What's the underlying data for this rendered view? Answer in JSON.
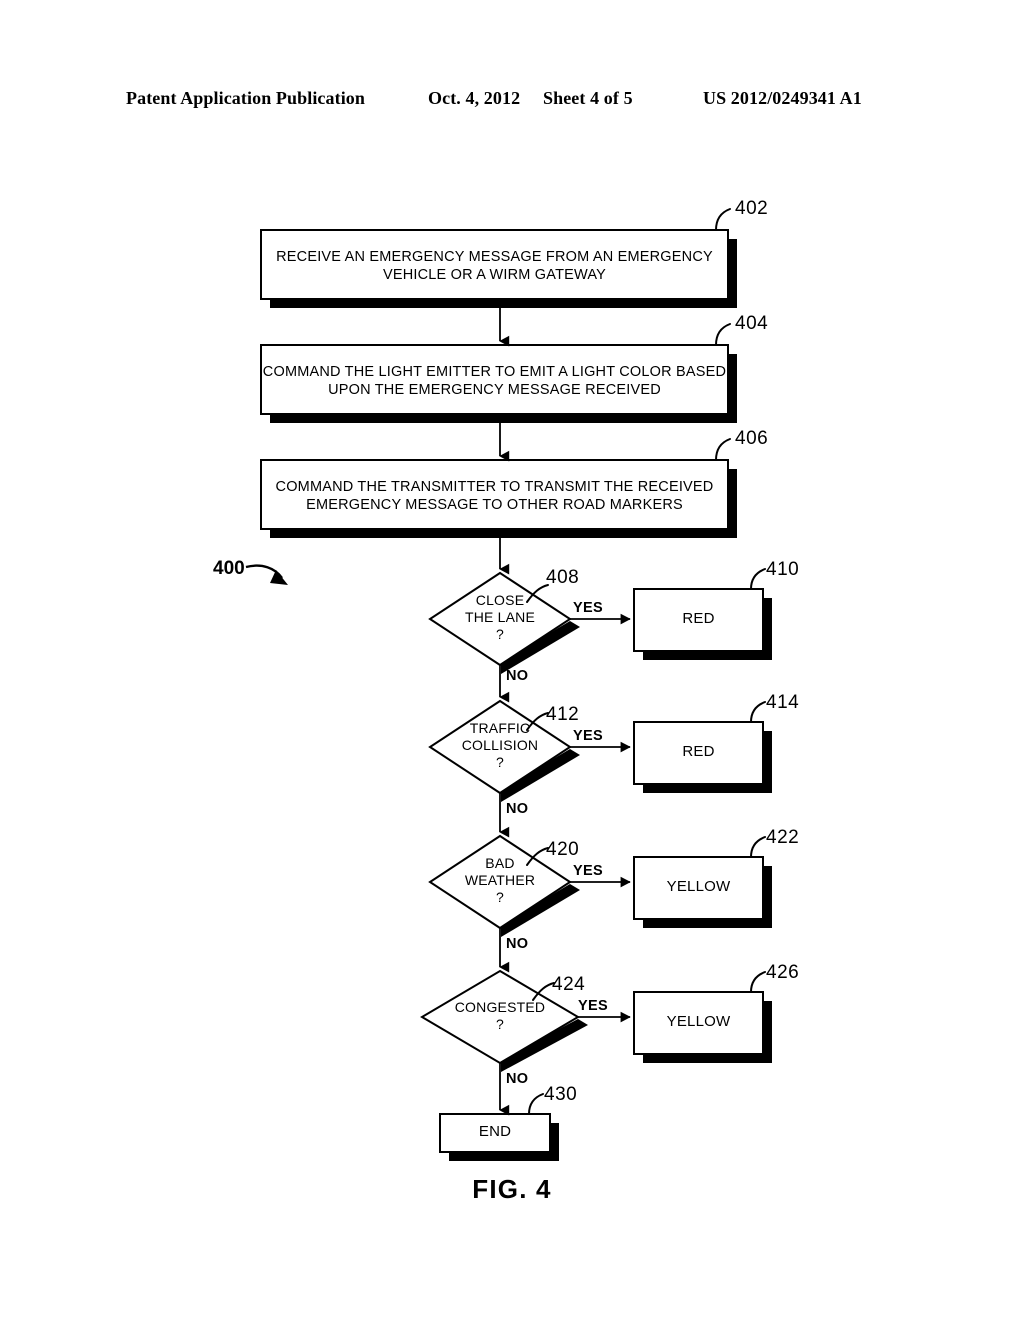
{
  "header": {
    "publication": "Patent Application Publication",
    "date": "Oct. 4, 2012",
    "sheet": "Sheet 4 of 5",
    "number": "US 2012/0249341 A1"
  },
  "figure": {
    "caption": "FIG. 4",
    "diagram_label": "400",
    "nodes": [
      {
        "id": "402",
        "ref": "402",
        "type": "process",
        "lines": [
          "RECEIVE AN EMERGENCY MESSAGE FROM AN EMERGENCY",
          "VEHICLE OR A WIRM GATEWAY"
        ]
      },
      {
        "id": "404",
        "ref": "404",
        "type": "process",
        "lines": [
          "COMMAND THE LIGHT EMITTER TO EMIT A LIGHT COLOR BASED",
          "UPON THE EMERGENCY MESSAGE RECEIVED"
        ]
      },
      {
        "id": "406",
        "ref": "406",
        "type": "process",
        "lines": [
          "COMMAND THE TRANSMITTER TO TRANSMIT THE RECEIVED",
          "EMERGENCY MESSAGE TO OTHER ROAD MARKERS"
        ]
      },
      {
        "id": "408",
        "ref": "408",
        "type": "decision",
        "lines": [
          "CLOSE",
          "THE LANE",
          "?"
        ]
      },
      {
        "id": "410",
        "ref": "410",
        "type": "terminal",
        "lines": [
          "RED"
        ]
      },
      {
        "id": "412",
        "ref": "412",
        "type": "decision",
        "lines": [
          "TRAFFIC",
          "COLLISION",
          "?"
        ]
      },
      {
        "id": "414",
        "ref": "414",
        "type": "terminal",
        "lines": [
          "RED"
        ]
      },
      {
        "id": "420",
        "ref": "420",
        "type": "decision",
        "lines": [
          "BAD",
          "WEATHER",
          "?"
        ]
      },
      {
        "id": "422",
        "ref": "422",
        "type": "terminal",
        "lines": [
          "YELLOW"
        ]
      },
      {
        "id": "424",
        "ref": "424",
        "type": "decision",
        "lines": [
          "CONGESTED",
          "?"
        ]
      },
      {
        "id": "426",
        "ref": "426",
        "type": "terminal",
        "lines": [
          "YELLOW"
        ]
      },
      {
        "id": "430",
        "ref": "430",
        "type": "terminal",
        "lines": [
          "END"
        ]
      }
    ],
    "branch_labels": {
      "yes": "YES",
      "no": "NO"
    },
    "text": {
      "n402_l1": "RECEIVE AN EMERGENCY MESSAGE FROM AN EMERGENCY",
      "n402_l2": "VEHICLE OR A WIRM GATEWAY",
      "n404_l1": "COMMAND THE LIGHT EMITTER TO EMIT A LIGHT COLOR BASED",
      "n404_l2": "UPON THE EMERGENCY MESSAGE RECEIVED",
      "n406_l1": "COMMAND THE TRANSMITTER TO TRANSMIT THE RECEIVED",
      "n406_l2": "EMERGENCY MESSAGE TO OTHER ROAD MARKERS",
      "n408_l1": "CLOSE",
      "n408_l2": "THE LANE",
      "n408_l3": "?",
      "n410_l1": "RED",
      "n412_l1": "TRAFFIC",
      "n412_l2": "COLLISION",
      "n412_l3": "?",
      "n414_l1": "RED",
      "n420_l1": "BAD",
      "n420_l2": "WEATHER",
      "n420_l3": "?",
      "n422_l1": "YELLOW",
      "n424_l1": "CONGESTED",
      "n424_l2": "?",
      "n426_l1": "YELLOW",
      "n430_l1": "END"
    },
    "refs": {
      "r402": "402",
      "r404": "404",
      "r406": "406",
      "r408": "408",
      "r410": "410",
      "r412": "412",
      "r414": "414",
      "r420": "420",
      "r422": "422",
      "r424": "424",
      "r426": "426",
      "r430": "430",
      "r400": "400"
    },
    "branches": {
      "yes1": "YES",
      "no1": "NO",
      "yes2": "YES",
      "no2": "NO",
      "yes3": "YES",
      "no3": "NO",
      "yes4": "YES",
      "no4": "NO"
    },
    "colors": {
      "ink": "#000000",
      "paper": "#ffffff"
    }
  }
}
